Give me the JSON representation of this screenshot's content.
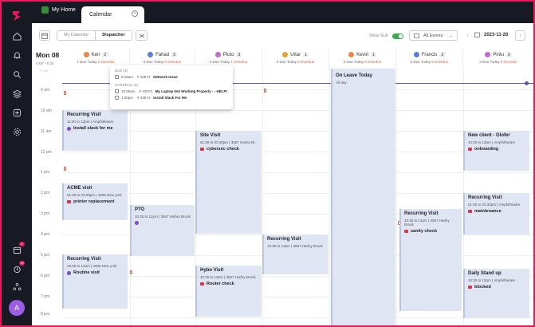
{
  "tabs": {
    "home": "My Home",
    "calendar": "Calendar"
  },
  "toolbar": {
    "view_my_calendar": "My Calendar",
    "view_dispatcher": "Dispatcher",
    "show_sla": "Show SLA",
    "all_events": "All Events",
    "date": "2023-11-26"
  },
  "sidebar": {
    "badge_calendar": "4",
    "badge_timer": "10",
    "avatar_letter": "A"
  },
  "grid": {
    "day": "Mon 08",
    "tz": "GMT +5:30",
    "hours": [
      "9 am",
      "10 am",
      "11 am",
      "12 pm",
      "1 pm",
      "2 pm",
      "3 pm",
      "4 pm",
      "5 pm",
      "6 pm",
      "7 pm",
      "8 pm"
    ],
    "first_hour_partial": "9 am"
  },
  "technicians": [
    {
      "name": "Ken",
      "count": "2",
      "due": "1 Due Today",
      "overdue": "2 Overdue",
      "color": "#e9884a"
    },
    {
      "name": "Fahad",
      "count": "3",
      "due": "5 Due Today",
      "overdue": "5 Overdue",
      "color": "#5a7fd6"
    },
    {
      "name": "Pluto",
      "count": "3",
      "due": "3 Due Today",
      "overdue": "1 Overdue",
      "color": "#c46ad9"
    },
    {
      "name": "Uttar",
      "count": "1",
      "due": "3 Due Today",
      "overdue": "5 Overdue",
      "color": "#e9a23a"
    },
    {
      "name": "Kevin",
      "count": "1",
      "due": "3 Due Today",
      "overdue": "5 Overdue",
      "color": "#e9884a"
    },
    {
      "name": "Francis",
      "count": "2",
      "due": "3 Due Today",
      "overdue": "5 Overdue",
      "color": "#5a7fd6"
    },
    {
      "name": "Pintu",
      "count": "3",
      "due": "3 Due Today",
      "overdue": "5 Overdue",
      "color": "#c46ad9"
    }
  ],
  "popup": {
    "due_label": "DUE (1)",
    "due_time": "9:15am",
    "due_id": "# 43574",
    "due_title": "Network Issue",
    "overdue_label": "OVERDUE (2)",
    "od1_time": "10:00am",
    "od1_id": "# 43574",
    "od1_title": "My Laptop Not Working Properly - - HELP!",
    "od2_time": "1:00pm",
    "od2_id": "# 43574",
    "od2_title": "Install Slack For Me"
  },
  "events": {
    "ken_recurring": {
      "title": "Recurring Visit",
      "time": "11:00 to 12pm | Amphitheatre",
      "tag": "Install slack for me"
    },
    "ken_acme": {
      "title": "ACME visit",
      "time": "01:30 to 03:00pm | 4608 New york",
      "tag": "printer replacement"
    },
    "ken_recurring2": {
      "title": "Recurring Visit",
      "time": "10:30 to 12pm | 4608 New york",
      "tag": "Routine visit"
    },
    "fahad_pto": {
      "title": "PTO",
      "time": "10:30 to 12pm | 3567 Harley Brook",
      "tag": ""
    },
    "pluto_site": {
      "title": "Site Visit",
      "time": "01:30 to 03:30pm | 3567 Harley Br..",
      "tag": "cybersec check"
    },
    "pluto_hybo": {
      "title": "Hybo Visit",
      "time": "10:30 to 12pm | 3567 Harley Brook",
      "tag": "Router check"
    },
    "uttar_recurring": {
      "title": "Recurring Visit",
      "time": "10:30 to 12pm | 3567 Harley Brook",
      "tag": ""
    },
    "kevin_leave": {
      "title": "On Leave Today",
      "time": "All day",
      "tag": ""
    },
    "francis_recurring": {
      "title": "Recurring Visit",
      "time": "10:30 to 12pm | 3567 Harley Brook",
      "tag": "sanity check"
    },
    "pintu_new": {
      "title": "New client - Glofer",
      "time": "10:30 to 12pm | Amphitheatre",
      "tag": "onboarding"
    },
    "pintu_recurring": {
      "title": "Recurring Visit",
      "time": "01:30 to 03:30pm | Amphitheatre",
      "tag": "maintenance"
    },
    "pintu_standup": {
      "title": "Daily Stand up",
      "time": "10:30 to 12pm | Amphitheatre",
      "tag": "blocked"
    }
  },
  "colors": {
    "accent": "#e9185a",
    "event_bg": "#dfe5f3",
    "now_line": "#5a5aa8",
    "toggle_on": "#3caa4a"
  }
}
